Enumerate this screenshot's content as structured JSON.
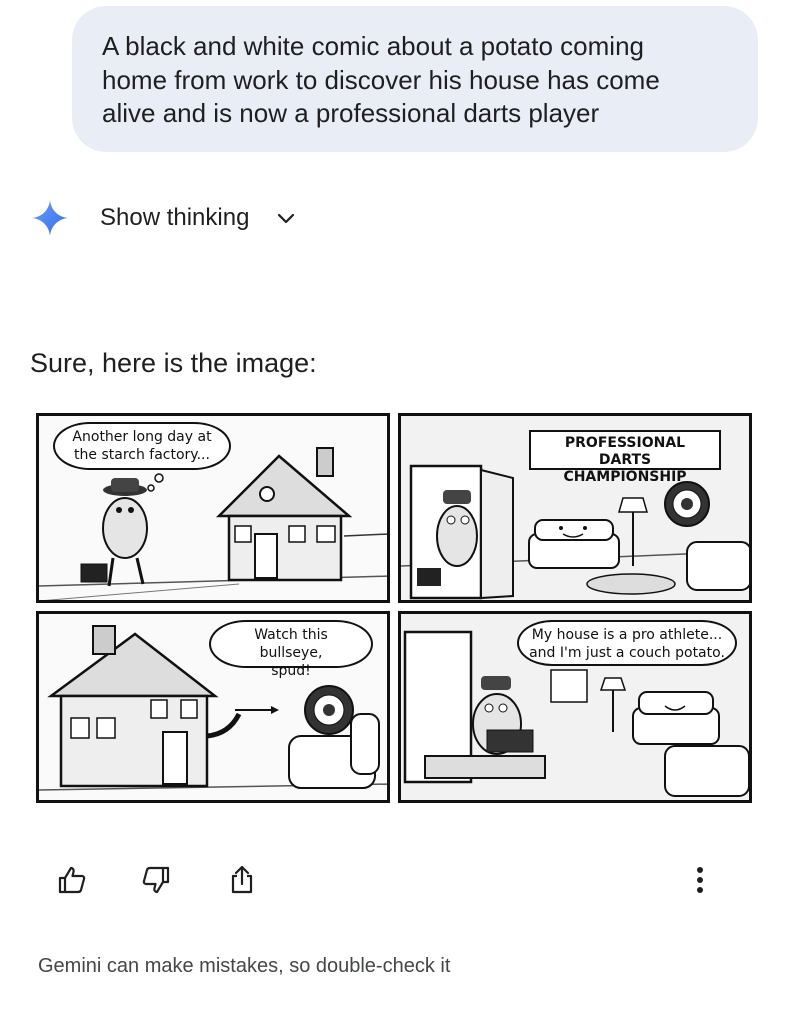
{
  "prompt": {
    "line1": "A black and white comic about a potato coming",
    "line2": "home from work to discover his house has come",
    "line3": "alive and is now a professional darts player"
  },
  "thinking": {
    "label": "Show thinking",
    "icon": "sparkle-icon",
    "toggle_icon": "chevron-down-icon",
    "accent": "#4c8df6"
  },
  "response": {
    "intro": "Sure, here is the image:",
    "comic": {
      "panel1": {
        "caption_line1": "Another long day at",
        "caption_line2": "the starch factory..."
      },
      "panel2": {
        "banner_line1": "PROFESSIONAL DARTS",
        "banner_line2": "CHAMPIONSHIP"
      },
      "panel3": {
        "speech_line1": "Watch this bullseye,",
        "speech_line2": "spud!"
      },
      "panel4": {
        "caption_line1": "My house is a pro athlete...",
        "caption_line2": "and I'm just a couch potato."
      }
    }
  },
  "actions": {
    "thumbs_up": "thumbs-up-icon",
    "thumbs_down": "thumbs-down-icon",
    "share": "share-icon",
    "more": "more-vertical-icon"
  },
  "footer": {
    "disclaimer": "Gemini can make mistakes, so double-check it"
  }
}
